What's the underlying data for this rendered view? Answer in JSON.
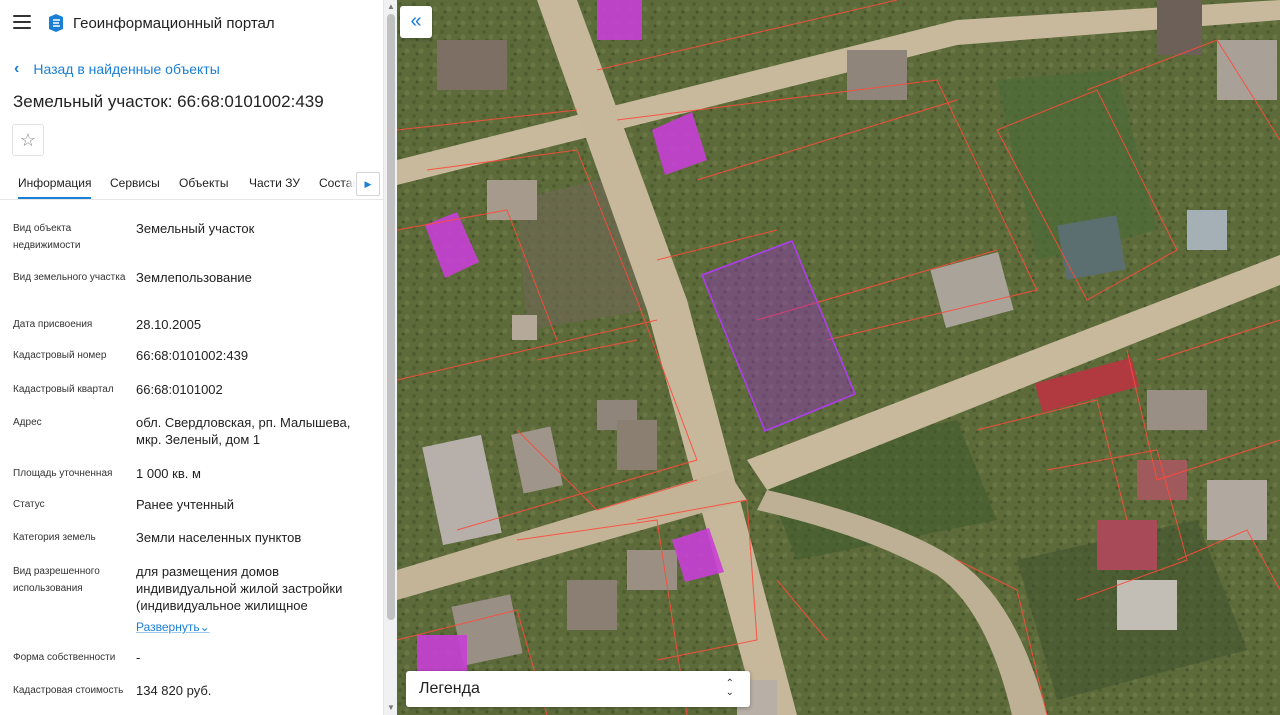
{
  "header": {
    "app_title": "Геоинформационный портал"
  },
  "back_link": {
    "label": "Назад в найденные объекты"
  },
  "object": {
    "title": "Земельный участок: 66:68:0101002:439"
  },
  "tabs": [
    "Информация",
    "Сервисы",
    "Объекты",
    "Части ЗУ",
    "Состав"
  ],
  "active_tab": "Информация",
  "properties": [
    {
      "label": "Вид объекта недвижимости",
      "value": "Земельный участок"
    },
    {
      "label": "Вид земельного участка",
      "value": "Землепользование"
    },
    {
      "label": "Дата присвоения",
      "value": "28.10.2005"
    },
    {
      "label": "Кадастровый номер",
      "value": "66:68:0101002:439"
    },
    {
      "label": "Кадастровый квартал",
      "value": "66:68:0101002"
    },
    {
      "label": "Адрес",
      "value": "обл. Свердловская, рп. Малышева, мкр. Зеленый, дом 1"
    },
    {
      "label": "Площадь уточненная",
      "value": "1 000 кв. м"
    },
    {
      "label": "Статус",
      "value": "Ранее учтенный"
    },
    {
      "label": "Категория земель",
      "value": "Земли населенных пунктов"
    },
    {
      "label": "Вид разрешенного использования",
      "value": "для размещения домов индивидуальной жилой застройки (индивидуальное жилищное",
      "expand_label": "Развернуть"
    },
    {
      "label": "Форма собственности",
      "value": "-"
    },
    {
      "label": "Кадастровая стоимость",
      "value": "134 820 руб."
    }
  ],
  "map": {
    "legend_label": "Легенда"
  },
  "colors": {
    "accent": "#1a7fd6",
    "parcel_highlight": "#a020f0",
    "boundary": "#ff4a3a"
  }
}
